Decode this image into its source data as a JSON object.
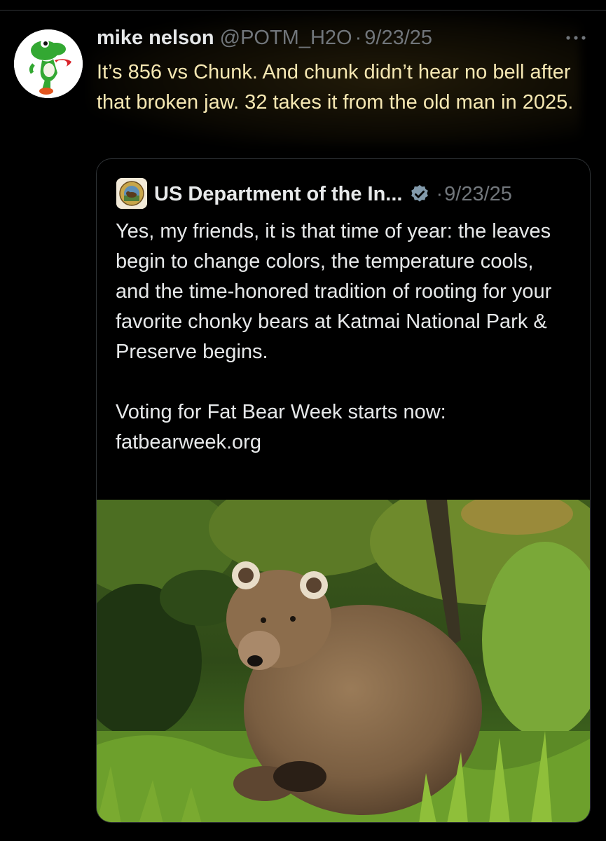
{
  "post": {
    "author_name": "mike nelson",
    "author_handle": "@POTM_H2O",
    "separator": "·",
    "date": "9/23/25",
    "text": "It’s 856 vs Chunk.  And chunk didn’t hear no bell after that broken jaw.  32 takes it from the old man in 2025.",
    "avatar_icon": "yoshi-avatar",
    "more_icon": "more-options-icon"
  },
  "quote": {
    "author_name": "US Department of the In...",
    "separator": "·",
    "date": "9/23/25",
    "verified_icon": "verified-badge-icon",
    "verified_color": "#829aab",
    "paragraph_1": "Yes, my friends, it is that time of year: the leaves begin to change colors, the temperature cools, and the time-honored tradition of rooting for your favorite chonky bears at Katmai National Park & Preserve begins.",
    "paragraph_2": "Voting for Fat Bear Week starts now:",
    "link": "fatbearweek.org",
    "image_alt": "brown bear sitting in green grass"
  },
  "colors": {
    "background": "#000000",
    "text": "#e7e9ea",
    "secondary": "#71767b",
    "highlight_text": "#f5e7b2",
    "border": "#2f3336"
  }
}
